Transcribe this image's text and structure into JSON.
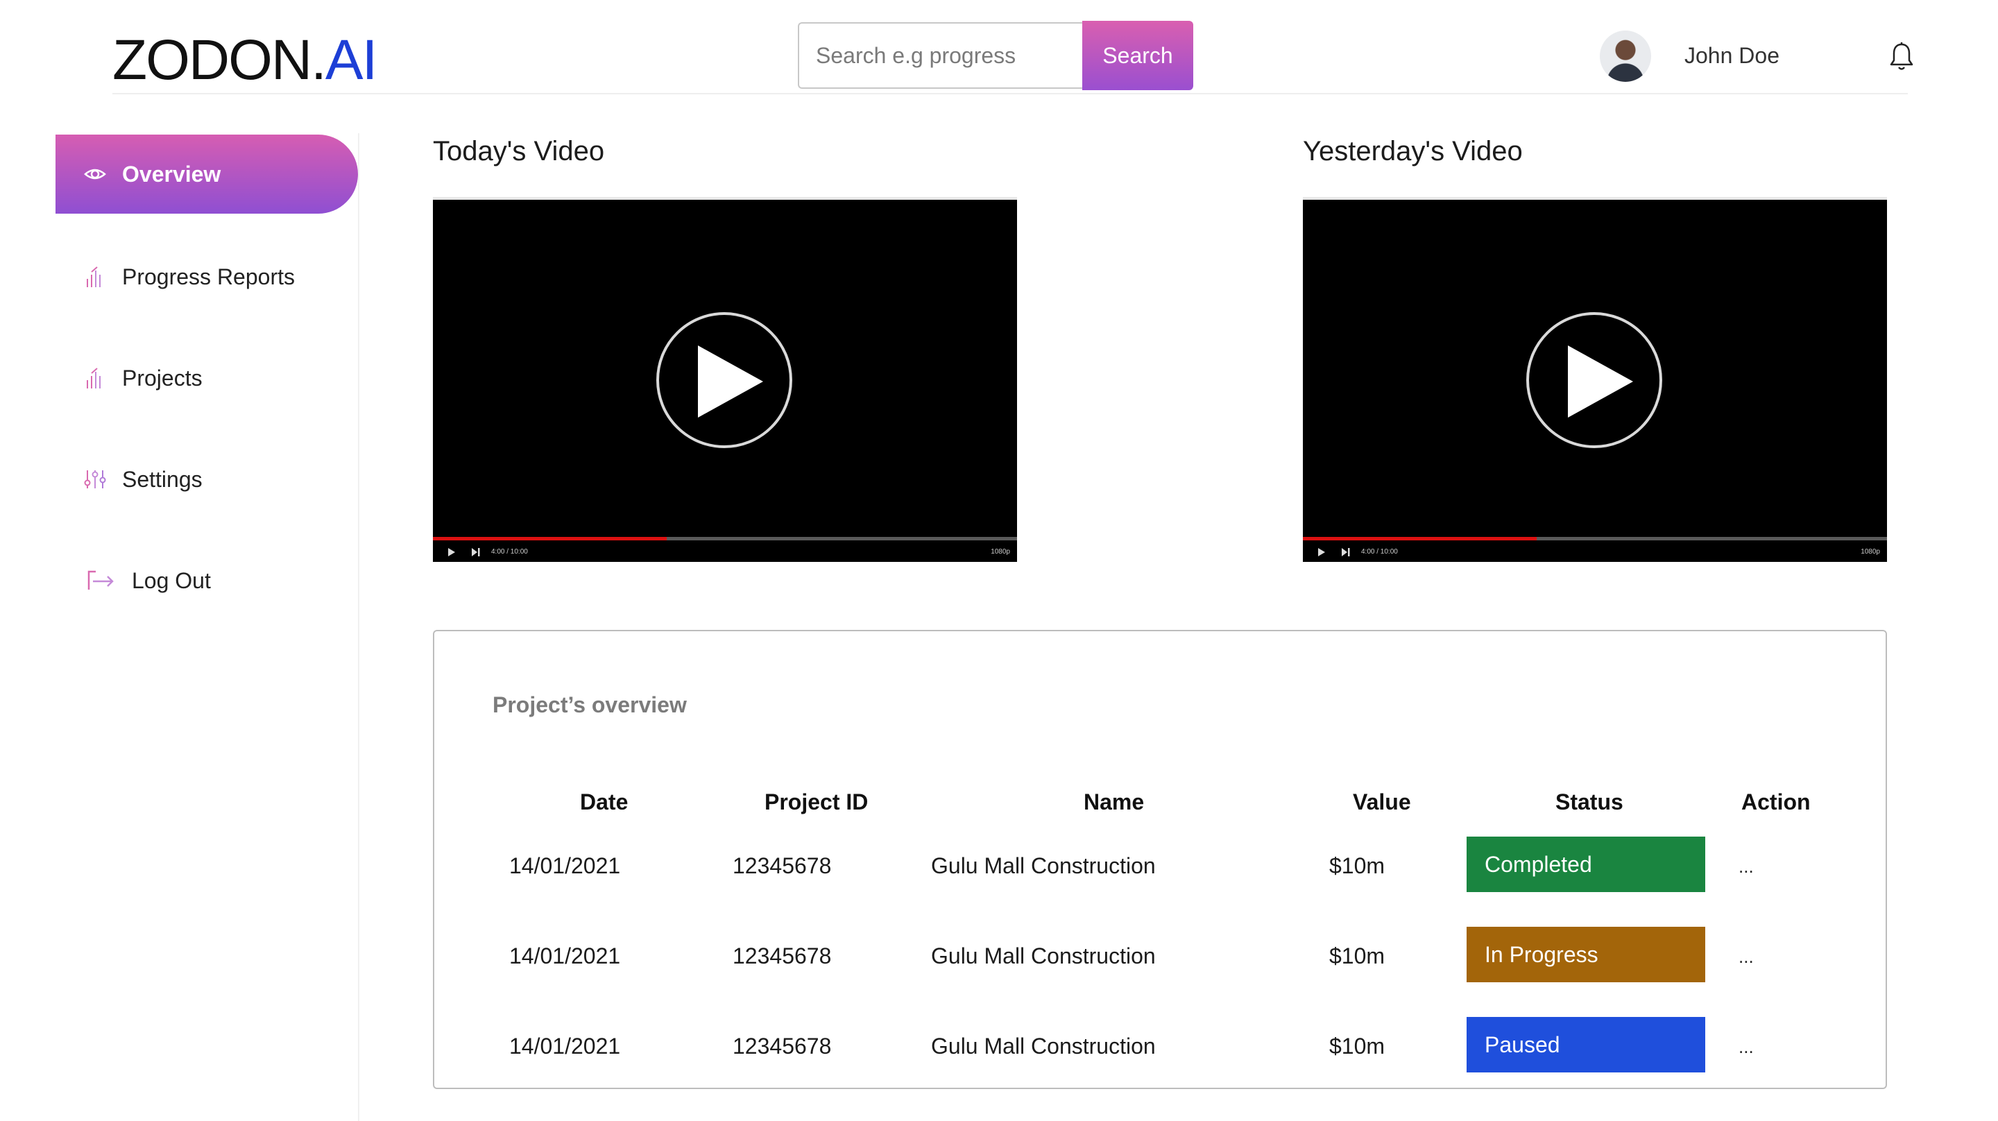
{
  "header": {
    "logo": {
      "brand": "ZODON",
      "dot": ".",
      "ai": "AI"
    },
    "search": {
      "placeholder": "Search e.g progress",
      "button": "Search"
    },
    "user": {
      "name": "John Doe"
    },
    "icons": {
      "notifications": "bell-icon",
      "avatar": "user-avatar"
    }
  },
  "sidebar": {
    "items": [
      {
        "label": "Overview",
        "icon": "eye-icon",
        "active": true
      },
      {
        "label": "Progress Reports",
        "icon": "bar-chart-icon",
        "active": false
      },
      {
        "label": "Projects",
        "icon": "bar-chart-icon",
        "active": false
      },
      {
        "label": "Settings",
        "icon": "sliders-icon",
        "active": false
      },
      {
        "label": "Log Out",
        "icon": "logout-arrow-icon",
        "active": false
      }
    ]
  },
  "videos": [
    {
      "title": "Today's Video",
      "time": "4:00 / 10:00",
      "quality": "1080p",
      "progress": 0.4
    },
    {
      "title": "Yesterday's Video",
      "time": "4:00 / 10:00",
      "quality": "1080p",
      "progress": 0.4
    }
  ],
  "overview": {
    "title": "Project’s overview",
    "columns": [
      "Date",
      "Project ID",
      "Name",
      "Value",
      "Status",
      "Action"
    ],
    "rows": [
      {
        "date": "14/01/2021",
        "project_id": "12345678",
        "name": "Gulu Mall Construction",
        "value": "$10m",
        "status": "Completed",
        "status_color": "#1a8540",
        "action": "..."
      },
      {
        "date": "14/01/2021",
        "project_id": "12345678",
        "name": "Gulu Mall Construction",
        "value": "$10m",
        "status": "In Progress",
        "status_color": "#a3650a",
        "action": "..."
      },
      {
        "date": "14/01/2021",
        "project_id": "12345678",
        "name": "Gulu Mall Construction",
        "value": "$10m",
        "status": "Paused",
        "status_color": "#1f4fdc",
        "action": "..."
      }
    ]
  },
  "colors": {
    "accent_start": "#d65db2",
    "accent_end": "#8f4fd2",
    "brand_blue": "#1d3fd6"
  }
}
